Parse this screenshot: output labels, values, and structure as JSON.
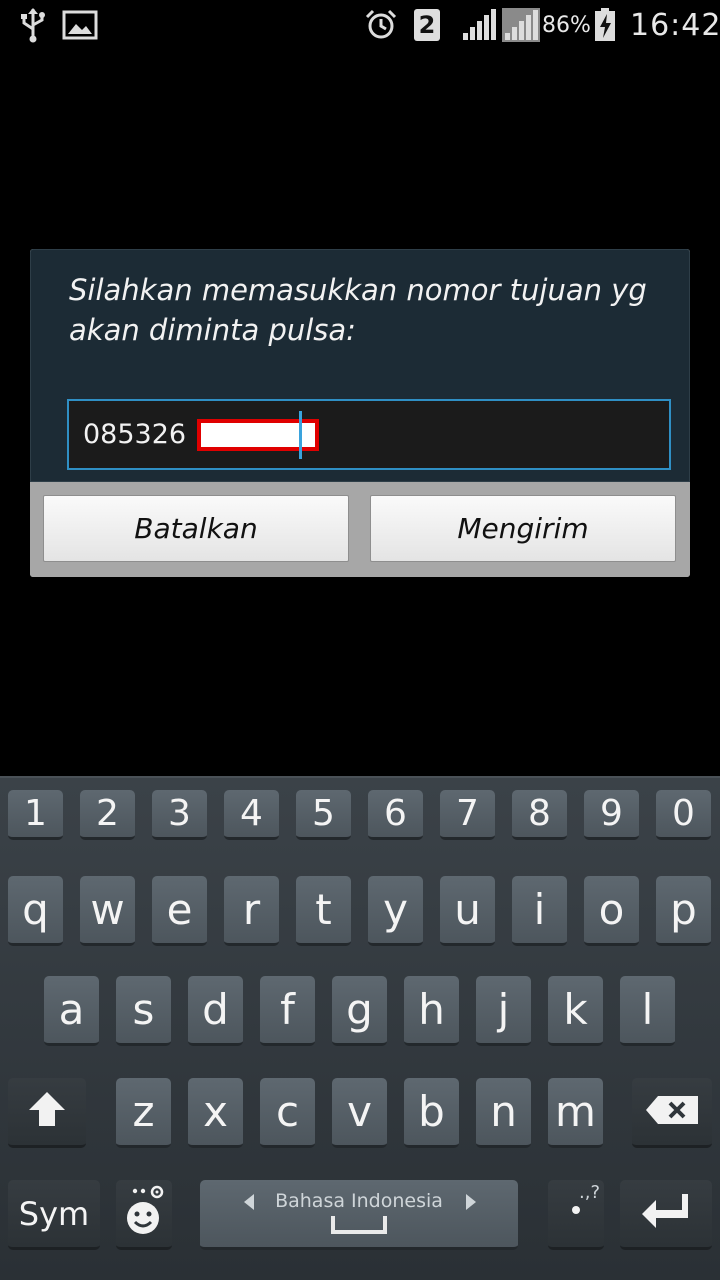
{
  "status_bar": {
    "icons": [
      "usb-icon",
      "gallery-icon",
      "alarm-icon",
      "sim-2-badge",
      "signal-icon",
      "signal-roaming-icon",
      "battery-charging-icon"
    ],
    "sim_number": "2",
    "battery_percent": "86%",
    "clock": "16:42"
  },
  "dialog": {
    "message": "Silahkan memasukkan nomor tujuan yg akan diminta pulsa:",
    "input_value": "085326",
    "cancel_label": "Batalkan",
    "send_label": "Mengirim"
  },
  "keyboard": {
    "number_row": [
      "1",
      "2",
      "3",
      "4",
      "5",
      "6",
      "7",
      "8",
      "9",
      "0"
    ],
    "row1": [
      "q",
      "w",
      "e",
      "r",
      "t",
      "y",
      "u",
      "i",
      "o",
      "p"
    ],
    "row2": [
      "a",
      "s",
      "d",
      "f",
      "g",
      "h",
      "j",
      "k",
      "l"
    ],
    "row3": [
      "z",
      "x",
      "c",
      "v",
      "b",
      "n",
      "m"
    ],
    "sym_label": "Sym",
    "space_label": "Bahasa Indonesia",
    "punct_hint": ".,?",
    "icons": [
      "shift-icon",
      "backspace-icon",
      "emoji-settings-icon",
      "enter-icon"
    ]
  },
  "colors": {
    "dialog_background": "#1c2b35",
    "input_border": "#2f8fc4",
    "keyboard_background": "#2f353a"
  }
}
